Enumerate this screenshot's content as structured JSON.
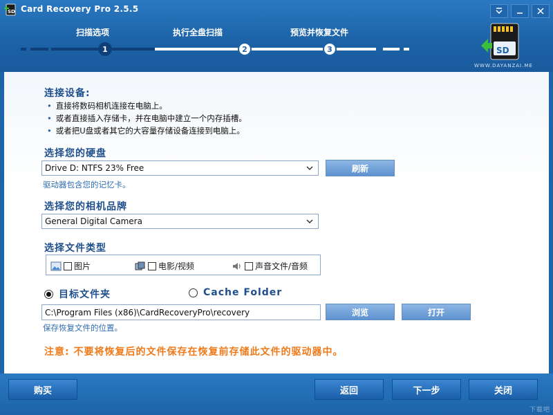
{
  "window": {
    "title": "Card Recovery Pro 2.5.5",
    "controls": [
      "minimize-to-menu",
      "minimize",
      "close"
    ]
  },
  "steps": [
    {
      "number": "1",
      "label": "扫描选项",
      "active": true
    },
    {
      "number": "2",
      "label": "执行全盘扫描",
      "active": false
    },
    {
      "number": "3",
      "label": "预览并恢复文件",
      "active": false
    }
  ],
  "logo": {
    "card_text": "SD",
    "watermark": "WWW.DAYANZAI.ME"
  },
  "connect": {
    "heading": "连接设备:",
    "bullets": [
      "直接将数码相机连接在电脑上。",
      "或者直接插入存储卡，并在电脑中建立一个内存插槽。",
      "或者把U盘或者其它的大容量存储设备连接到电脑上。"
    ]
  },
  "drive": {
    "heading": "选择您的硬盘",
    "value": "Drive D: NTFS 23% Free",
    "refresh_label": "刷新",
    "hint": "驱动器包含您的记忆卡。"
  },
  "camera": {
    "heading": "选择您的相机品牌",
    "value": "General Digital Camera"
  },
  "filetypes": {
    "heading": "选择文件类型",
    "items": [
      {
        "label": "图片",
        "icon": "picture-icon",
        "checked": false
      },
      {
        "label": "电影/视频",
        "icon": "film-icon",
        "checked": false
      },
      {
        "label": "声音文件/音频",
        "icon": "speaker-icon",
        "checked": false
      }
    ]
  },
  "destination": {
    "target_label": "目标文件夹",
    "cache_label": "Cache Folder",
    "selected": "target",
    "path": "C:\\Program Files (x86)\\CardRecoveryPro\\recovery",
    "browse_label": "浏览",
    "open_label": "打开",
    "hint": "保存恢复文件的位置。"
  },
  "warning": "注意: 不要将恢复后的文件保存在恢复前存储此文件的驱动器中。",
  "footer": {
    "buy_label": "购买",
    "back_label": "返回",
    "next_label": "下一步",
    "close_label": "关闭",
    "watermark": "下载吧"
  },
  "colors": {
    "header_blue": "#1d63a8",
    "step_active": "#0e3f78",
    "heading_text": "#1f4f8c",
    "hint_text": "#2f6db0",
    "warning_text": "#f07a1a"
  }
}
